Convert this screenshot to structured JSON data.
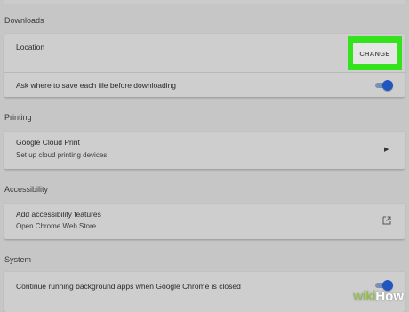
{
  "downloads": {
    "title": "Downloads",
    "location_label": "Location",
    "change_label": "CHANGE",
    "ask_label": "Ask where to save each file before downloading",
    "ask_enabled": true
  },
  "printing": {
    "title": "Printing",
    "cloud_print_label": "Google Cloud Print",
    "cloud_print_sub": "Set up cloud printing devices"
  },
  "accessibility": {
    "title": "Accessibility",
    "add_label": "Add accessibility features",
    "add_sub": "Open Chrome Web Store"
  },
  "system": {
    "title": "System",
    "background_label": "Continue running background apps when Google Chrome is closed",
    "background_enabled": true
  },
  "watermark": {
    "wiki": "wiki",
    "how": "How"
  },
  "colors": {
    "highlight": "#35e21e",
    "toggle_on": "#1f56c0",
    "background": "#c6c6c6"
  }
}
